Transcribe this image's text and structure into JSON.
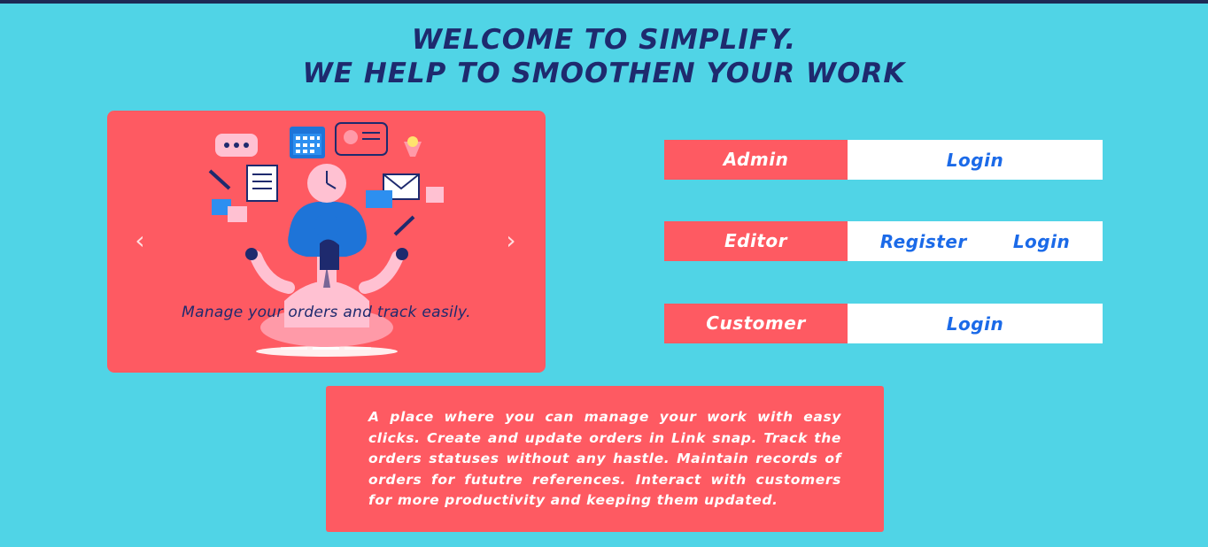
{
  "header": {
    "line1": "WELCOME TO SIMPLIFY.",
    "line2": "WE HELP TO SMOOTHEN YOUR WORK"
  },
  "carousel": {
    "caption": "Manage your orders and track easily.",
    "prev_icon": "chevron-left-icon",
    "next_icon": "chevron-right-icon",
    "slide_count": 3,
    "active_slide": 2
  },
  "roles": {
    "admin": {
      "label": "Admin",
      "login": "Login"
    },
    "editor": {
      "label": "Editor",
      "register": "Register",
      "login": "Login"
    },
    "customer": {
      "label": "Customer",
      "login": "Login"
    }
  },
  "about": {
    "text": "A place where you can manage your work with easy clicks. Create and update orders in Link snap. Track the orders statuses without any hastle. Maintain records of orders for fututre references. Interact with customers for more productivity and keeping them updated."
  },
  "colors": {
    "background": "#50d4e6",
    "accent": "#fe5a62",
    "heading": "#1e2a6e",
    "link": "#1b6ae8"
  }
}
